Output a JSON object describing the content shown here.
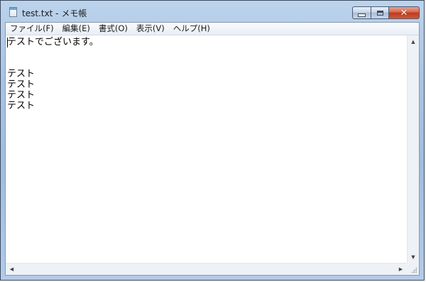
{
  "window": {
    "title": "test.txt - メモ帳",
    "icon": "notepad-icon"
  },
  "caption_buttons": {
    "minimize_icon": "minimize-icon",
    "maximize_icon": "maximize-icon",
    "close_icon": "close-icon",
    "close_glyph": "✕"
  },
  "menu": {
    "items": [
      {
        "label": "ファイル(F)"
      },
      {
        "label": "編集(E)"
      },
      {
        "label": "書式(O)"
      },
      {
        "label": "表示(V)"
      },
      {
        "label": "ヘルプ(H)"
      }
    ]
  },
  "editor": {
    "lines": [
      "テストでございます。",
      "",
      "",
      "テスト",
      "テスト",
      "テスト",
      "テスト"
    ]
  },
  "scrollbars": {
    "up_arrow": "▲",
    "down_arrow": "▼",
    "left_arrow": "◀",
    "right_arrow": "▶"
  }
}
